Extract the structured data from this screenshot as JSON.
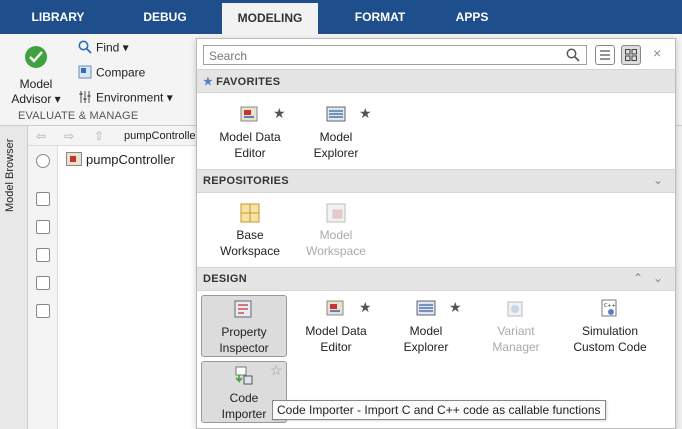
{
  "tabs": [
    "LIBRARY",
    "DEBUG",
    "MODELING",
    "FORMAT",
    "APPS"
  ],
  "active_tab": "MODELING",
  "toolstrip": {
    "model_advisor_label": "Model",
    "model_advisor_label2": "Advisor",
    "find_label": "Find",
    "compare_label": "Compare",
    "environment_label": "Environment",
    "section_label": "EVALUATE & MANAGE"
  },
  "browser": {
    "side_label": "Model Browser",
    "address": "pumpController",
    "tree_item": "pumpController"
  },
  "gallery": {
    "search_placeholder": "Search",
    "close_label": "×",
    "favorites": {
      "title": "FAVORITES",
      "items": [
        {
          "label1": "Model Data",
          "label2": "Editor",
          "icon": "model-data-editor-icon"
        },
        {
          "label1": "Model",
          "label2": "Explorer",
          "icon": "model-explorer-icon"
        }
      ]
    },
    "repositories": {
      "title": "REPOSITORIES",
      "items": [
        {
          "label1": "Base",
          "label2": "Workspace",
          "icon": "base-workspace-icon"
        },
        {
          "label1": "Model",
          "label2": "Workspace",
          "icon": "model-workspace-icon"
        }
      ]
    },
    "design": {
      "title": "DESIGN",
      "items": [
        {
          "label1": "Property",
          "label2": "Inspector",
          "icon": "property-inspector-icon"
        },
        {
          "label1": "Model Data",
          "label2": "Editor",
          "icon": "model-data-editor-icon"
        },
        {
          "label1": "Model",
          "label2": "Explorer",
          "icon": "model-explorer-icon"
        },
        {
          "label1": "Variant",
          "label2": "Manager",
          "icon": "variant-manager-icon"
        },
        {
          "label1": "Simulation",
          "label2": "Custom Code",
          "icon": "simulation-custom-code-icon"
        },
        {
          "label1": "Code",
          "label2": "Importer",
          "icon": "code-importer-icon"
        }
      ]
    }
  },
  "tooltip": "Code Importer - Import C and C++ code as callable functions"
}
